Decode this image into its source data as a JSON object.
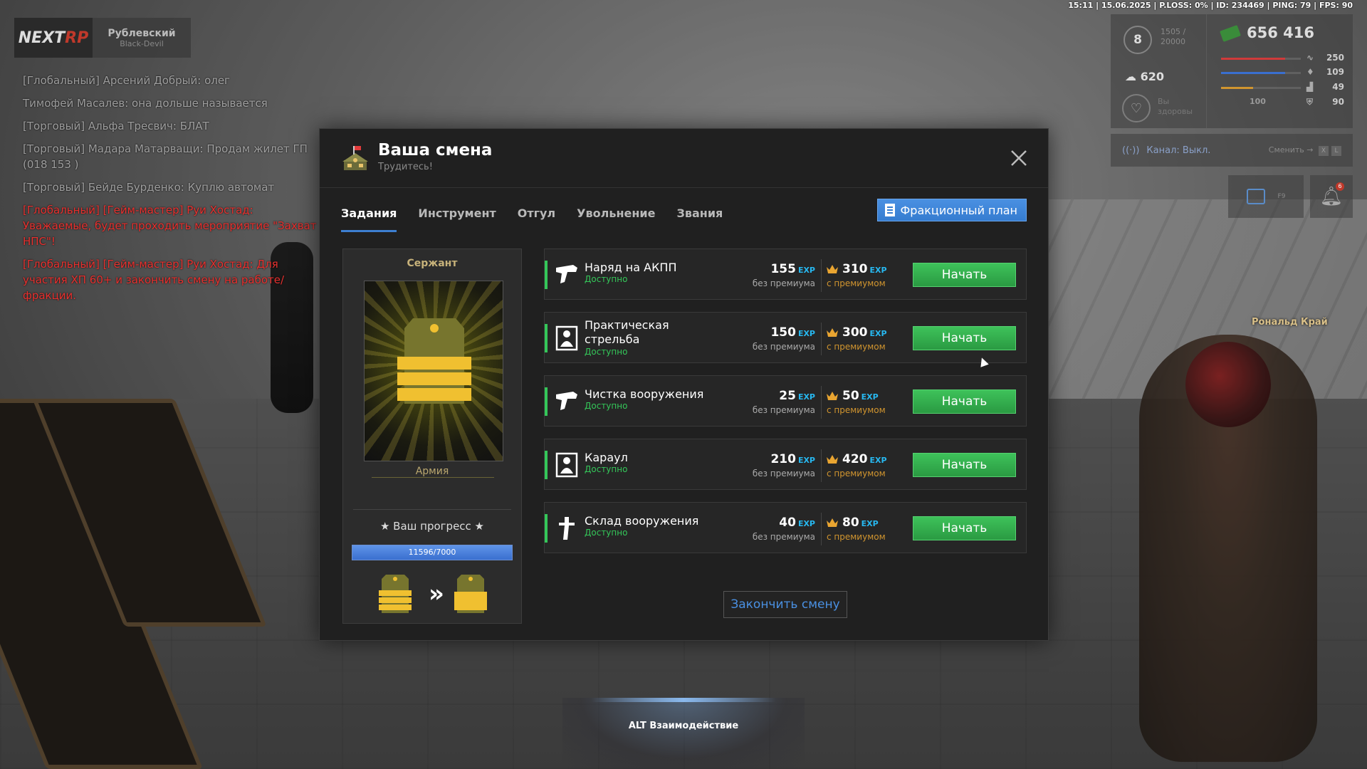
{
  "hud_status": "15:11 | 15.06.2025 | P.LOSS: 0% | ID: 234469 | PING: 79 | FPS: 90",
  "logo": {
    "server_name": "Рублевский",
    "server_sub": "Black-Devil"
  },
  "chat": [
    {
      "text": "[Глобальный] Арсений Добрый: олег",
      "red": false
    },
    {
      "text": "Тимофей Масалев: она дольше называется",
      "red": false
    },
    {
      "text": "[Торговый] Альфа Тресвич: БЛАТ",
      "red": false
    },
    {
      "text": "[Торговый] Мадара Матарващи: Продам жилет ГП (018 153 )",
      "red": false
    },
    {
      "text": "[Торговый] Бейде Бурденко: Куплю автомат",
      "red": false
    },
    {
      "text": "[Глобальный] [Гейм-мастер] Руи Хостад: Уважаемые, будет проходить мероприятие \"Захват НПС\"!",
      "red": true
    },
    {
      "text": "[Глобальный] [Гейм-мастер] Руи Хостад: Для участия ХП 60+ и закончить смену на работе/фракции.",
      "red": true
    }
  ],
  "hud": {
    "level": "8",
    "level_xp": "1505 / 20000",
    "hunger": "620",
    "health_label": "Вы здоровы",
    "money": "656 416",
    "stats": [
      {
        "value": "250",
        "fill": 0.8,
        "color": "#d03a3a"
      },
      {
        "value": "109",
        "fill": 0.8,
        "color": "#3a6fcf"
      },
      {
        "value": "49",
        "fill": 0.4,
        "color": "#d1952f"
      },
      {
        "value": "90",
        "fill": 0.0,
        "color": "#888888"
      }
    ],
    "extra": "100"
  },
  "voice": {
    "label": "Канал: Выкл.",
    "change": "Сменить"
  },
  "calendar_key": "F9",
  "bell_count": "6",
  "player_name": "Рональд Край",
  "alt_hint": "ALT Взаимодействие",
  "modal": {
    "title": "Ваша смена",
    "subtitle": "Трудитесь!",
    "tabs": [
      "Задания",
      "Инструмент",
      "Отгул",
      "Увольнение",
      "Звания"
    ],
    "active_tab": 0,
    "faction_plan": "Фракционный план",
    "end_shift": "Закончить смену",
    "rank": {
      "name": "Сержант",
      "faction": "Армия",
      "progress_title": "★ Ваш прогресс ★",
      "progress_text": "11596/7000",
      "progress": 1.0
    },
    "tasks": [
      {
        "name": "Наряд на АКПП",
        "status": "Доступно",
        "exp": "155",
        "exp_premium": "310",
        "icon": "pistol-icon"
      },
      {
        "name": "Практическая стрельба",
        "status": "Доступно",
        "exp": "150",
        "exp_premium": "300",
        "icon": "target-icon"
      },
      {
        "name": "Чистка вооружения",
        "status": "Доступно",
        "exp": "25",
        "exp_premium": "50",
        "icon": "pistol-icon"
      },
      {
        "name": "Караул",
        "status": "Доступно",
        "exp": "210",
        "exp_premium": "420",
        "icon": "target-icon"
      },
      {
        "name": "Склад вооружения",
        "status": "Доступно",
        "exp": "40",
        "exp_premium": "80",
        "icon": "rifle-icon"
      }
    ],
    "labels": {
      "exp_unit": "EXP",
      "no_premium": "без премиума",
      "with_premium": "с премиумом",
      "start": "Начать"
    }
  }
}
